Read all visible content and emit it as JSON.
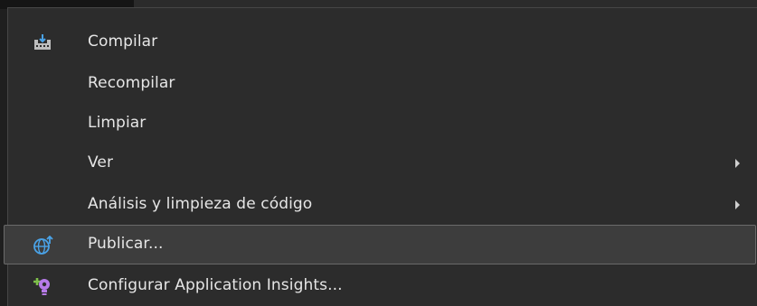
{
  "menu": {
    "items": [
      {
        "label": "Compilar",
        "icon": "build-icon",
        "submenu": false
      },
      {
        "label": "Recompilar",
        "icon": "",
        "submenu": false
      },
      {
        "label": "Limpiar",
        "icon": "",
        "submenu": false
      },
      {
        "label": "Ver",
        "icon": "",
        "submenu": true
      },
      {
        "label": "Análisis y limpieza de código",
        "icon": "",
        "submenu": true
      },
      {
        "label": "Publicar...",
        "icon": "publish-globe-icon",
        "submenu": false,
        "highlighted": true
      },
      {
        "label": "Configurar Application Insights...",
        "icon": "application-insights-icon",
        "submenu": false
      }
    ]
  },
  "colors": {
    "menu_background": "#2c2c2c",
    "hover_background": "#3d3d3d",
    "text": "#e6e6e6",
    "icon_blue": "#4aa3e8",
    "insights_purple": "#b77be8",
    "insights_green": "#7ec04a"
  }
}
